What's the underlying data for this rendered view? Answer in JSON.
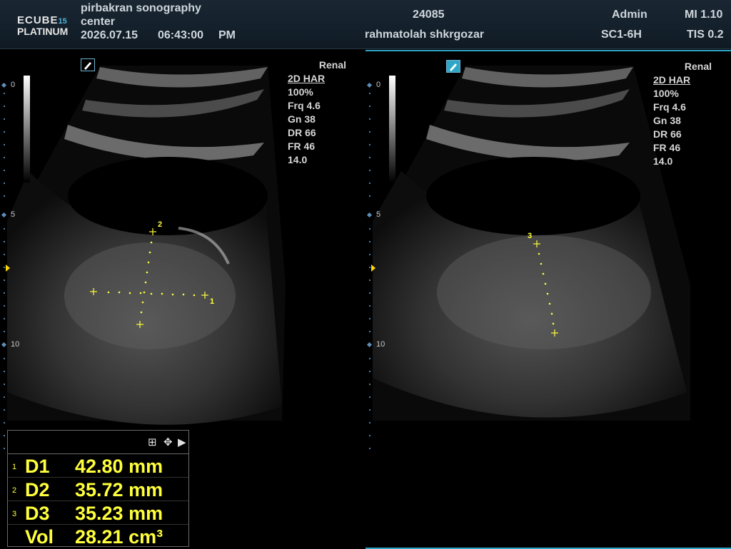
{
  "header": {
    "logo_line1": "ECUBE",
    "logo_line1_num": "15",
    "logo_line2": "PLATINUM",
    "institution": "pirbakran sonography",
    "institution_line2": "center",
    "date": "2026.07.15",
    "time": "06:43:00",
    "ampm": "PM",
    "patient_id": "24085",
    "patient_name": "rahmatolah shkrgozar",
    "operator": "Admin",
    "probe": "SC1-6H",
    "mi": "MI 1.10",
    "tis": "TIS 0.2"
  },
  "left_panel": {
    "preset": "Renal",
    "params": [
      "2D HAR",
      "100%",
      "Frq 4.6",
      "Gn 38",
      "DR 66",
      "FR 46",
      "14.0"
    ],
    "depth_labels": [
      "0",
      "5",
      "10"
    ],
    "calipers": [
      "1",
      "2"
    ]
  },
  "right_panel": {
    "preset": "Renal",
    "params": [
      "2D HAR",
      "100%",
      "Frq 4.6",
      "Gn 38",
      "DR 66",
      "FR 46",
      "14.0"
    ],
    "depth_labels": [
      "0",
      "5",
      "10"
    ],
    "calipers": [
      "3"
    ]
  },
  "measurements": {
    "toolbar_icons": [
      "grid-icon",
      "move-icon",
      "play-icon"
    ],
    "rows": [
      {
        "index": "1",
        "name": "D1",
        "value": "42.80 mm"
      },
      {
        "index": "2",
        "name": "D2",
        "value": "35.72 mm"
      },
      {
        "index": "3",
        "name": "D3",
        "value": "35.23 mm"
      },
      {
        "index": "",
        "name": "Vol",
        "value": "28.21 cm³"
      }
    ]
  },
  "colors": {
    "caliper": "#ffff3c",
    "accent": "#2fa6c6",
    "focus_marker": "#ffd800"
  }
}
